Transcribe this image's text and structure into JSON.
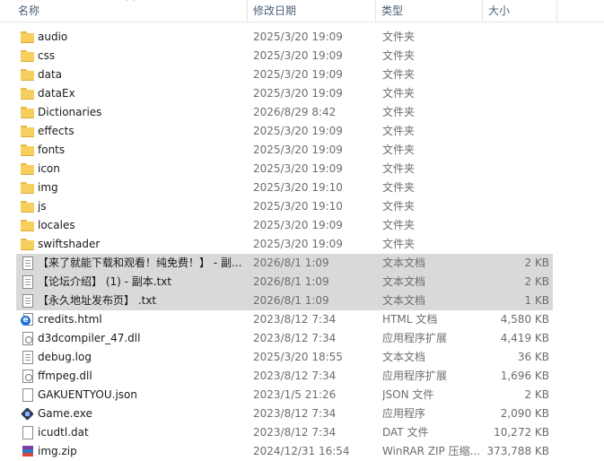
{
  "header": {
    "name": "名称",
    "date": "修改日期",
    "type": "类型",
    "size": "大小"
  },
  "files": [
    {
      "name": "audio",
      "date": "2025/3/20 19:09",
      "type": "文件夹",
      "size": "",
      "icon": "folder"
    },
    {
      "name": "css",
      "date": "2025/3/20 19:09",
      "type": "文件夹",
      "size": "",
      "icon": "folder"
    },
    {
      "name": "data",
      "date": "2025/3/20 19:09",
      "type": "文件夹",
      "size": "",
      "icon": "folder"
    },
    {
      "name": "dataEx",
      "date": "2025/3/20 19:09",
      "type": "文件夹",
      "size": "",
      "icon": "folder"
    },
    {
      "name": "Dictionaries",
      "date": "2026/8/29 8:42",
      "type": "文件夹",
      "size": "",
      "icon": "folder"
    },
    {
      "name": "effects",
      "date": "2025/3/20 19:09",
      "type": "文件夹",
      "size": "",
      "icon": "folder"
    },
    {
      "name": "fonts",
      "date": "2025/3/20 19:09",
      "type": "文件夹",
      "size": "",
      "icon": "folder"
    },
    {
      "name": "icon",
      "date": "2025/3/20 19:09",
      "type": "文件夹",
      "size": "",
      "icon": "folder"
    },
    {
      "name": "img",
      "date": "2025/3/20 19:10",
      "type": "文件夹",
      "size": "",
      "icon": "folder"
    },
    {
      "name": "js",
      "date": "2025/3/20 19:10",
      "type": "文件夹",
      "size": "",
      "icon": "folder"
    },
    {
      "name": "locales",
      "date": "2025/3/20 19:09",
      "type": "文件夹",
      "size": "",
      "icon": "folder"
    },
    {
      "name": "swiftshader",
      "date": "2025/3/20 19:09",
      "type": "文件夹",
      "size": "",
      "icon": "folder"
    },
    {
      "name": "【来了就能下载和观看！纯免费！】 - 副...",
      "date": "2026/8/1 1:09",
      "type": "文本文档",
      "size": "2 KB",
      "icon": "text",
      "selected": true
    },
    {
      "name": "【论坛介绍】 (1) - 副本.txt",
      "date": "2026/8/1 1:09",
      "type": "文本文档",
      "size": "2 KB",
      "icon": "text",
      "selected": true
    },
    {
      "name": "【永久地址发布页】 .txt",
      "date": "2026/8/1 1:09",
      "type": "文本文档",
      "size": "1 KB",
      "icon": "text",
      "selected": true
    },
    {
      "name": "credits.html",
      "date": "2023/8/12 7:34",
      "type": "HTML 文档",
      "size": "4,580 KB",
      "icon": "html"
    },
    {
      "name": "d3dcompiler_47.dll",
      "date": "2023/8/12 7:34",
      "type": "应用程序扩展",
      "size": "4,419 KB",
      "icon": "dll"
    },
    {
      "name": "debug.log",
      "date": "2025/3/20 18:55",
      "type": "文本文档",
      "size": "36 KB",
      "icon": "text"
    },
    {
      "name": "ffmpeg.dll",
      "date": "2023/8/12 7:34",
      "type": "应用程序扩展",
      "size": "1,696 KB",
      "icon": "dll"
    },
    {
      "name": "GAKUENTYOU.json",
      "date": "2023/1/5 21:26",
      "type": "JSON 文件",
      "size": "2 KB",
      "icon": "blank"
    },
    {
      "name": "Game.exe",
      "date": "2023/8/12 7:34",
      "type": "应用程序",
      "size": "2,090 KB",
      "icon": "exe"
    },
    {
      "name": "icudtl.dat",
      "date": "2023/8/12 7:34",
      "type": "DAT 文件",
      "size": "10,272 KB",
      "icon": "blank"
    },
    {
      "name": "img.zip",
      "date": "2024/12/31 16:54",
      "type": "WinRAR ZIP 压缩...",
      "size": "373,788 KB",
      "icon": "zip"
    }
  ]
}
